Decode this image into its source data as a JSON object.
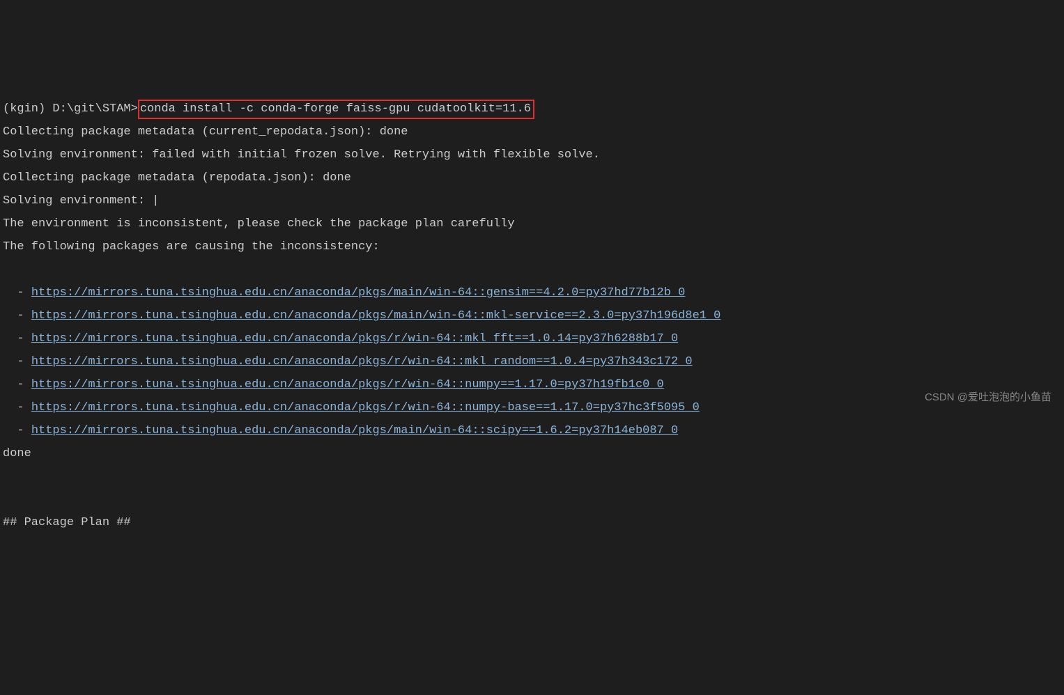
{
  "prompt": "(kgin) D:\\git\\STAM>",
  "command": "conda install -c conda-forge faiss-gpu cudatoolkit=11.6",
  "lines": {
    "l1": "Collecting package metadata (current_repodata.json): done",
    "l2": "Solving environment: failed with initial frozen solve. Retrying with flexible solve.",
    "l3": "Collecting package metadata (repodata.json): done",
    "l4": "Solving environment: |",
    "l5": "The environment is inconsistent, please check the package plan carefully",
    "l6": "The following packages are causing the inconsistency:",
    "l7": "done",
    "l8": "## Package Plan ##"
  },
  "bullet": "  - ",
  "packages": [
    "https://mirrors.tuna.tsinghua.edu.cn/anaconda/pkgs/main/win-64::gensim==4.2.0=py37hd77b12b_0",
    "https://mirrors.tuna.tsinghua.edu.cn/anaconda/pkgs/main/win-64::mkl-service==2.3.0=py37h196d8e1_0",
    "https://mirrors.tuna.tsinghua.edu.cn/anaconda/pkgs/r/win-64::mkl_fft==1.0.14=py37h6288b17_0",
    "https://mirrors.tuna.tsinghua.edu.cn/anaconda/pkgs/r/win-64::mkl_random==1.0.4=py37h343c172_0",
    "https://mirrors.tuna.tsinghua.edu.cn/anaconda/pkgs/r/win-64::numpy==1.17.0=py37h19fb1c0_0",
    "https://mirrors.tuna.tsinghua.edu.cn/anaconda/pkgs/r/win-64::numpy-base==1.17.0=py37hc3f5095_0",
    "https://mirrors.tuna.tsinghua.edu.cn/anaconda/pkgs/main/win-64::scipy==1.6.2=py37h14eb087_0"
  ],
  "watermark": "CSDN @爱吐泡泡的小鱼苗"
}
